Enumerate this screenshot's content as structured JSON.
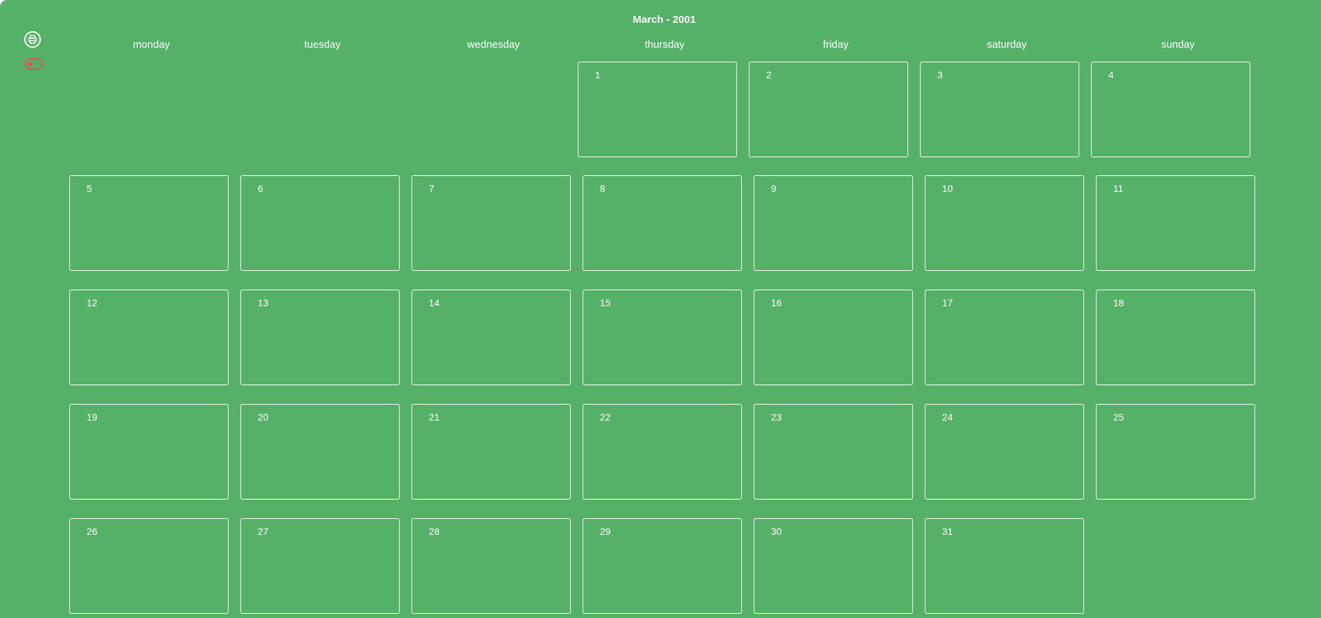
{
  "calendar": {
    "title": "March - 2001",
    "weekdays": [
      "monday",
      "tuesday",
      "wednesday",
      "thursday",
      "friday",
      "saturday",
      "sunday"
    ],
    "first_week": [
      "1",
      "2",
      "3",
      "4"
    ],
    "weeks": [
      [
        "5",
        "6",
        "7",
        "8",
        "9",
        "10",
        "11"
      ],
      [
        "12",
        "13",
        "14",
        "15",
        "16",
        "17",
        "18"
      ],
      [
        "19",
        "20",
        "21",
        "22",
        "23",
        "24",
        "25"
      ],
      [
        "26",
        "27",
        "28",
        "29",
        "30",
        "31"
      ]
    ]
  },
  "toolbar": {
    "print_icon": "printer-icon",
    "toggle_icon": "toggle-icon",
    "toggle_state": "off"
  },
  "colors": {
    "background": "#55b168",
    "text": "#ffffff",
    "toggle": "#e05454"
  }
}
